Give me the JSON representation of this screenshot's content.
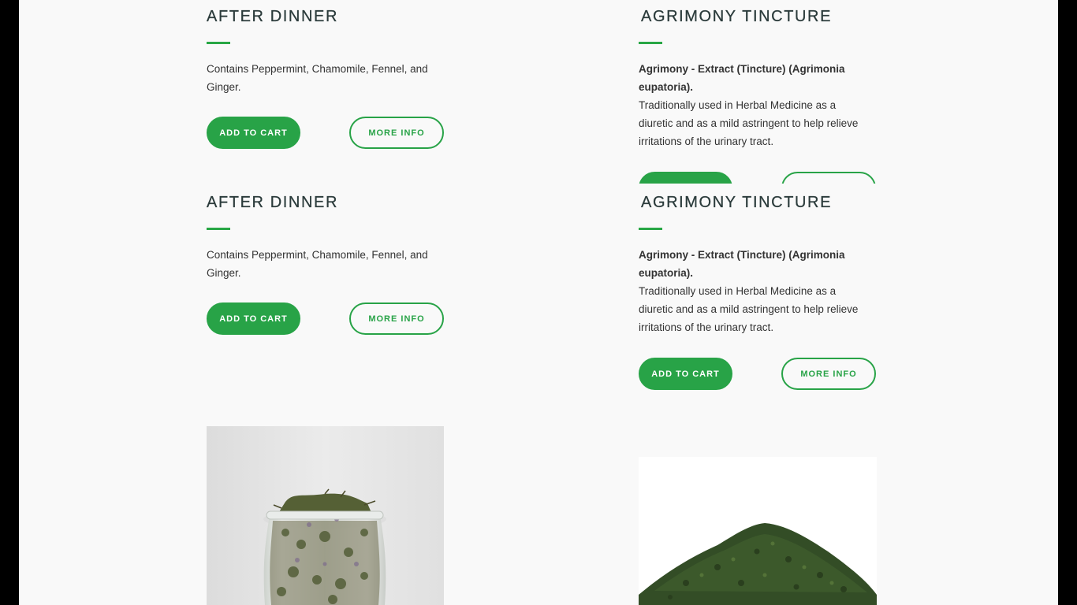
{
  "products": [
    {
      "title": "AFTER DINNER",
      "description": "Contains Peppermint, Chamomile, Fennel, and Ginger.",
      "add_to_cart": "ADD TO CART",
      "more_info": "MORE INFO"
    },
    {
      "title": "AGRIMONY TINCTURE",
      "description_bold": "Agrimony - Extract (Tincture) (Agrimonia eupatoria).",
      "description": "Traditionally used in Herbal Medicine as a diuretic and as a mild astringent to help relieve irritations of the urinary tract.",
      "add_to_cart": "ADD TO CART",
      "more_info": "MORE INFO"
    }
  ],
  "images": [
    {
      "subject": "glass jar of dried herbal tea"
    },
    {
      "subject": "pile of dried green herb"
    }
  ],
  "colors": {
    "accent": "#28a347",
    "background": "#f9f9f9",
    "frame": "#000000"
  }
}
